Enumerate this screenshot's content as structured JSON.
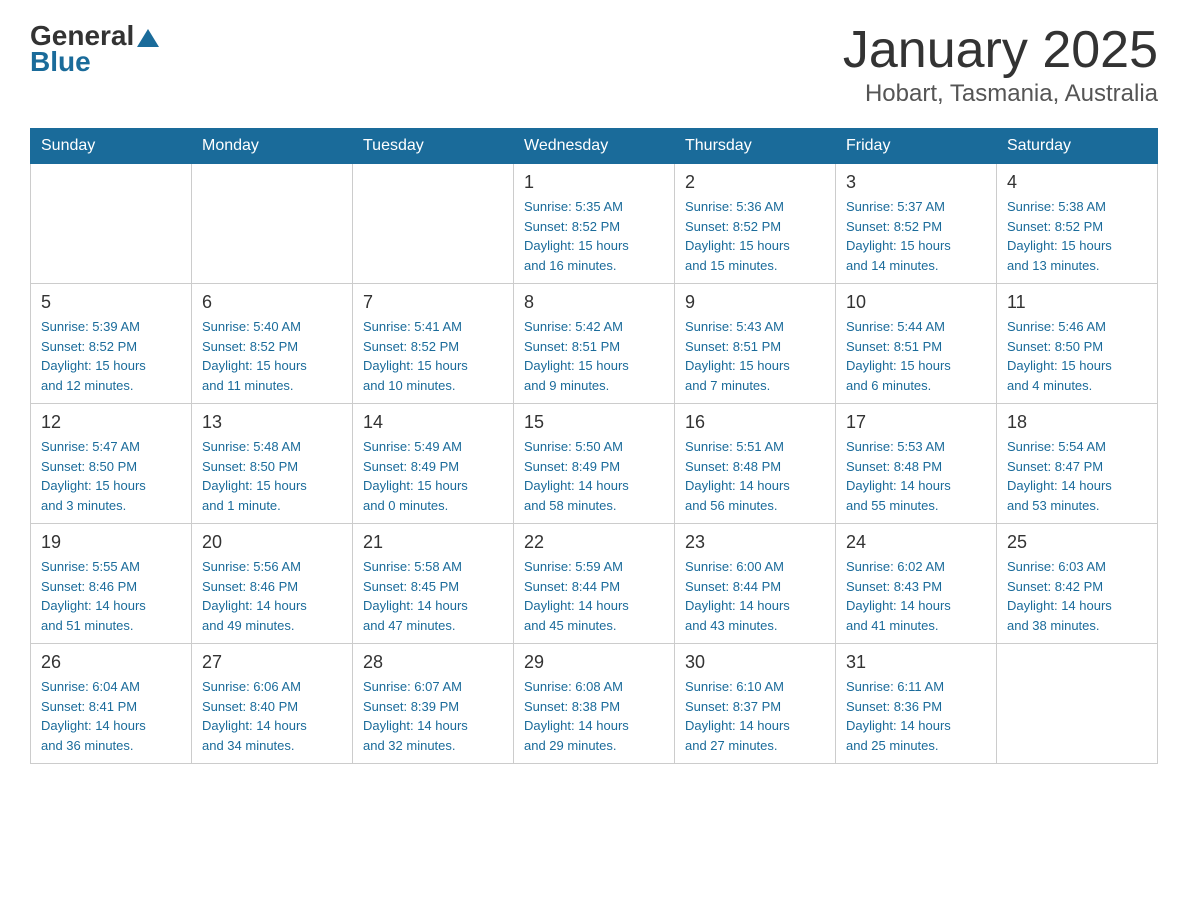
{
  "header": {
    "logo_general": "General",
    "logo_blue": "Blue",
    "title": "January 2025",
    "subtitle": "Hobart, Tasmania, Australia"
  },
  "weekdays": [
    "Sunday",
    "Monday",
    "Tuesday",
    "Wednesday",
    "Thursday",
    "Friday",
    "Saturday"
  ],
  "weeks": [
    [
      {
        "day": "",
        "info": ""
      },
      {
        "day": "",
        "info": ""
      },
      {
        "day": "",
        "info": ""
      },
      {
        "day": "1",
        "info": "Sunrise: 5:35 AM\nSunset: 8:52 PM\nDaylight: 15 hours\nand 16 minutes."
      },
      {
        "day": "2",
        "info": "Sunrise: 5:36 AM\nSunset: 8:52 PM\nDaylight: 15 hours\nand 15 minutes."
      },
      {
        "day": "3",
        "info": "Sunrise: 5:37 AM\nSunset: 8:52 PM\nDaylight: 15 hours\nand 14 minutes."
      },
      {
        "day": "4",
        "info": "Sunrise: 5:38 AM\nSunset: 8:52 PM\nDaylight: 15 hours\nand 13 minutes."
      }
    ],
    [
      {
        "day": "5",
        "info": "Sunrise: 5:39 AM\nSunset: 8:52 PM\nDaylight: 15 hours\nand 12 minutes."
      },
      {
        "day": "6",
        "info": "Sunrise: 5:40 AM\nSunset: 8:52 PM\nDaylight: 15 hours\nand 11 minutes."
      },
      {
        "day": "7",
        "info": "Sunrise: 5:41 AM\nSunset: 8:52 PM\nDaylight: 15 hours\nand 10 minutes."
      },
      {
        "day": "8",
        "info": "Sunrise: 5:42 AM\nSunset: 8:51 PM\nDaylight: 15 hours\nand 9 minutes."
      },
      {
        "day": "9",
        "info": "Sunrise: 5:43 AM\nSunset: 8:51 PM\nDaylight: 15 hours\nand 7 minutes."
      },
      {
        "day": "10",
        "info": "Sunrise: 5:44 AM\nSunset: 8:51 PM\nDaylight: 15 hours\nand 6 minutes."
      },
      {
        "day": "11",
        "info": "Sunrise: 5:46 AM\nSunset: 8:50 PM\nDaylight: 15 hours\nand 4 minutes."
      }
    ],
    [
      {
        "day": "12",
        "info": "Sunrise: 5:47 AM\nSunset: 8:50 PM\nDaylight: 15 hours\nand 3 minutes."
      },
      {
        "day": "13",
        "info": "Sunrise: 5:48 AM\nSunset: 8:50 PM\nDaylight: 15 hours\nand 1 minute."
      },
      {
        "day": "14",
        "info": "Sunrise: 5:49 AM\nSunset: 8:49 PM\nDaylight: 15 hours\nand 0 minutes."
      },
      {
        "day": "15",
        "info": "Sunrise: 5:50 AM\nSunset: 8:49 PM\nDaylight: 14 hours\nand 58 minutes."
      },
      {
        "day": "16",
        "info": "Sunrise: 5:51 AM\nSunset: 8:48 PM\nDaylight: 14 hours\nand 56 minutes."
      },
      {
        "day": "17",
        "info": "Sunrise: 5:53 AM\nSunset: 8:48 PM\nDaylight: 14 hours\nand 55 minutes."
      },
      {
        "day": "18",
        "info": "Sunrise: 5:54 AM\nSunset: 8:47 PM\nDaylight: 14 hours\nand 53 minutes."
      }
    ],
    [
      {
        "day": "19",
        "info": "Sunrise: 5:55 AM\nSunset: 8:46 PM\nDaylight: 14 hours\nand 51 minutes."
      },
      {
        "day": "20",
        "info": "Sunrise: 5:56 AM\nSunset: 8:46 PM\nDaylight: 14 hours\nand 49 minutes."
      },
      {
        "day": "21",
        "info": "Sunrise: 5:58 AM\nSunset: 8:45 PM\nDaylight: 14 hours\nand 47 minutes."
      },
      {
        "day": "22",
        "info": "Sunrise: 5:59 AM\nSunset: 8:44 PM\nDaylight: 14 hours\nand 45 minutes."
      },
      {
        "day": "23",
        "info": "Sunrise: 6:00 AM\nSunset: 8:44 PM\nDaylight: 14 hours\nand 43 minutes."
      },
      {
        "day": "24",
        "info": "Sunrise: 6:02 AM\nSunset: 8:43 PM\nDaylight: 14 hours\nand 41 minutes."
      },
      {
        "day": "25",
        "info": "Sunrise: 6:03 AM\nSunset: 8:42 PM\nDaylight: 14 hours\nand 38 minutes."
      }
    ],
    [
      {
        "day": "26",
        "info": "Sunrise: 6:04 AM\nSunset: 8:41 PM\nDaylight: 14 hours\nand 36 minutes."
      },
      {
        "day": "27",
        "info": "Sunrise: 6:06 AM\nSunset: 8:40 PM\nDaylight: 14 hours\nand 34 minutes."
      },
      {
        "day": "28",
        "info": "Sunrise: 6:07 AM\nSunset: 8:39 PM\nDaylight: 14 hours\nand 32 minutes."
      },
      {
        "day": "29",
        "info": "Sunrise: 6:08 AM\nSunset: 8:38 PM\nDaylight: 14 hours\nand 29 minutes."
      },
      {
        "day": "30",
        "info": "Sunrise: 6:10 AM\nSunset: 8:37 PM\nDaylight: 14 hours\nand 27 minutes."
      },
      {
        "day": "31",
        "info": "Sunrise: 6:11 AM\nSunset: 8:36 PM\nDaylight: 14 hours\nand 25 minutes."
      },
      {
        "day": "",
        "info": ""
      }
    ]
  ]
}
